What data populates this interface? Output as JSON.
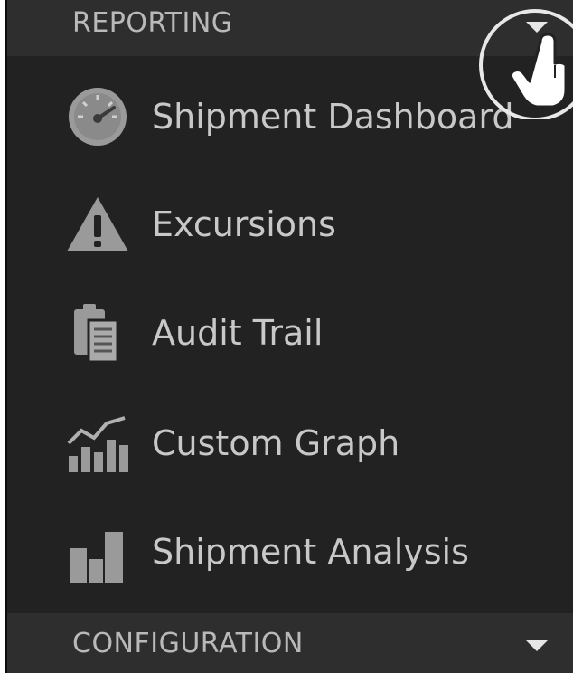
{
  "reporting": {
    "title": "REPORTING",
    "items": [
      {
        "label": "Shipment Dashboard",
        "icon": "speedometer-icon"
      },
      {
        "label": "Excursions",
        "icon": "warning-icon"
      },
      {
        "label": "Audit Trail",
        "icon": "clipboard-icon"
      },
      {
        "label": "Custom Graph",
        "icon": "graph-icon"
      },
      {
        "label": "Shipment Analysis",
        "icon": "bar-chart-icon"
      }
    ]
  },
  "configuration": {
    "title": "CONFIGURATION"
  },
  "colors": {
    "panel_bg": "#222222",
    "header_bg": "#2e2e2e",
    "text": "#c8c8c8",
    "icon": "#9a9a9a"
  }
}
